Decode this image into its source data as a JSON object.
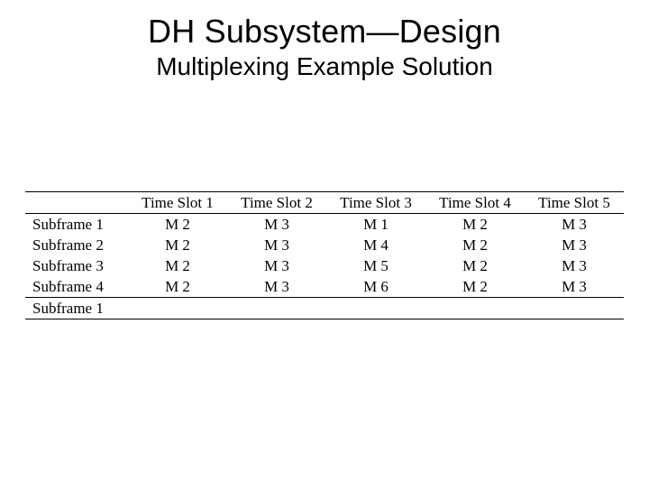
{
  "title": "DH Subsystem—Design",
  "subtitle": "Multiplexing Example Solution",
  "chart_data": {
    "type": "table",
    "columns": [
      "",
      "Time Slot 1",
      "Time Slot 2",
      "Time Slot 3",
      "Time Slot 4",
      "Time Slot 5"
    ],
    "rows": [
      {
        "label": "Subframe 1",
        "cells": [
          "M 2",
          "M 3",
          "M 1",
          "M 2",
          "M 3"
        ]
      },
      {
        "label": "Subframe 2",
        "cells": [
          "M 2",
          "M 3",
          "M 4",
          "M 2",
          "M 3"
        ]
      },
      {
        "label": "Subframe 3",
        "cells": [
          "M 2",
          "M 3",
          "M 5",
          "M 2",
          "M 3"
        ]
      },
      {
        "label": "Subframe 4",
        "cells": [
          "M 2",
          "M 3",
          "M 6",
          "M 2",
          "M 3"
        ]
      },
      {
        "label": "Subframe 1",
        "cells": [
          "",
          "",
          "",
          "",
          ""
        ]
      }
    ]
  }
}
